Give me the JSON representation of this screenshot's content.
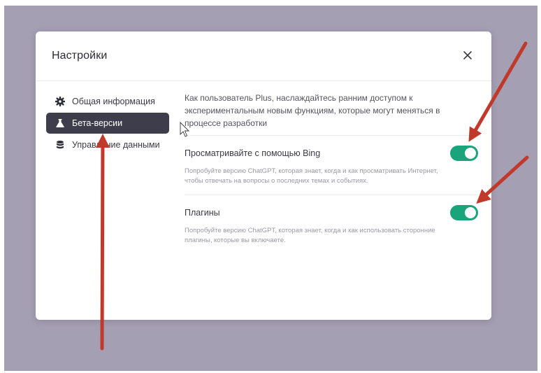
{
  "dialog": {
    "title": "Настройки",
    "close_icon": "close-icon"
  },
  "sidebar": {
    "items": [
      {
        "label": "Общая информация",
        "icon": "gear-icon",
        "active": false
      },
      {
        "label": "Бета-версии",
        "icon": "flask-icon",
        "active": true
      },
      {
        "label": "Управление данными",
        "icon": "database-icon",
        "active": false
      }
    ]
  },
  "beta": {
    "intro": "Как пользователь Plus, наслаждайтесь ранним доступом к экспериментальным новым функциям, которые могут меняться в процессе разработки",
    "settings": [
      {
        "label": "Просматривайте с помощью Bing",
        "description": "Попробуйте версию ChatGPT, которая знает, когда и как просматривать Интернет, чтобы отвечать на вопросы о последних темах и событиях.",
        "enabled": true
      },
      {
        "label": "Плагины",
        "description": "Попробуйте версию ChatGPT, которая знает, когда и как использовать сторонние плагины, которые вы включаете.",
        "enabled": true
      }
    ]
  },
  "colors": {
    "backdrop": "#a59fb3",
    "active_item": "#3e3d4b",
    "toggle_on": "#1aa47c",
    "annotation_arrow": "#c0392b"
  }
}
